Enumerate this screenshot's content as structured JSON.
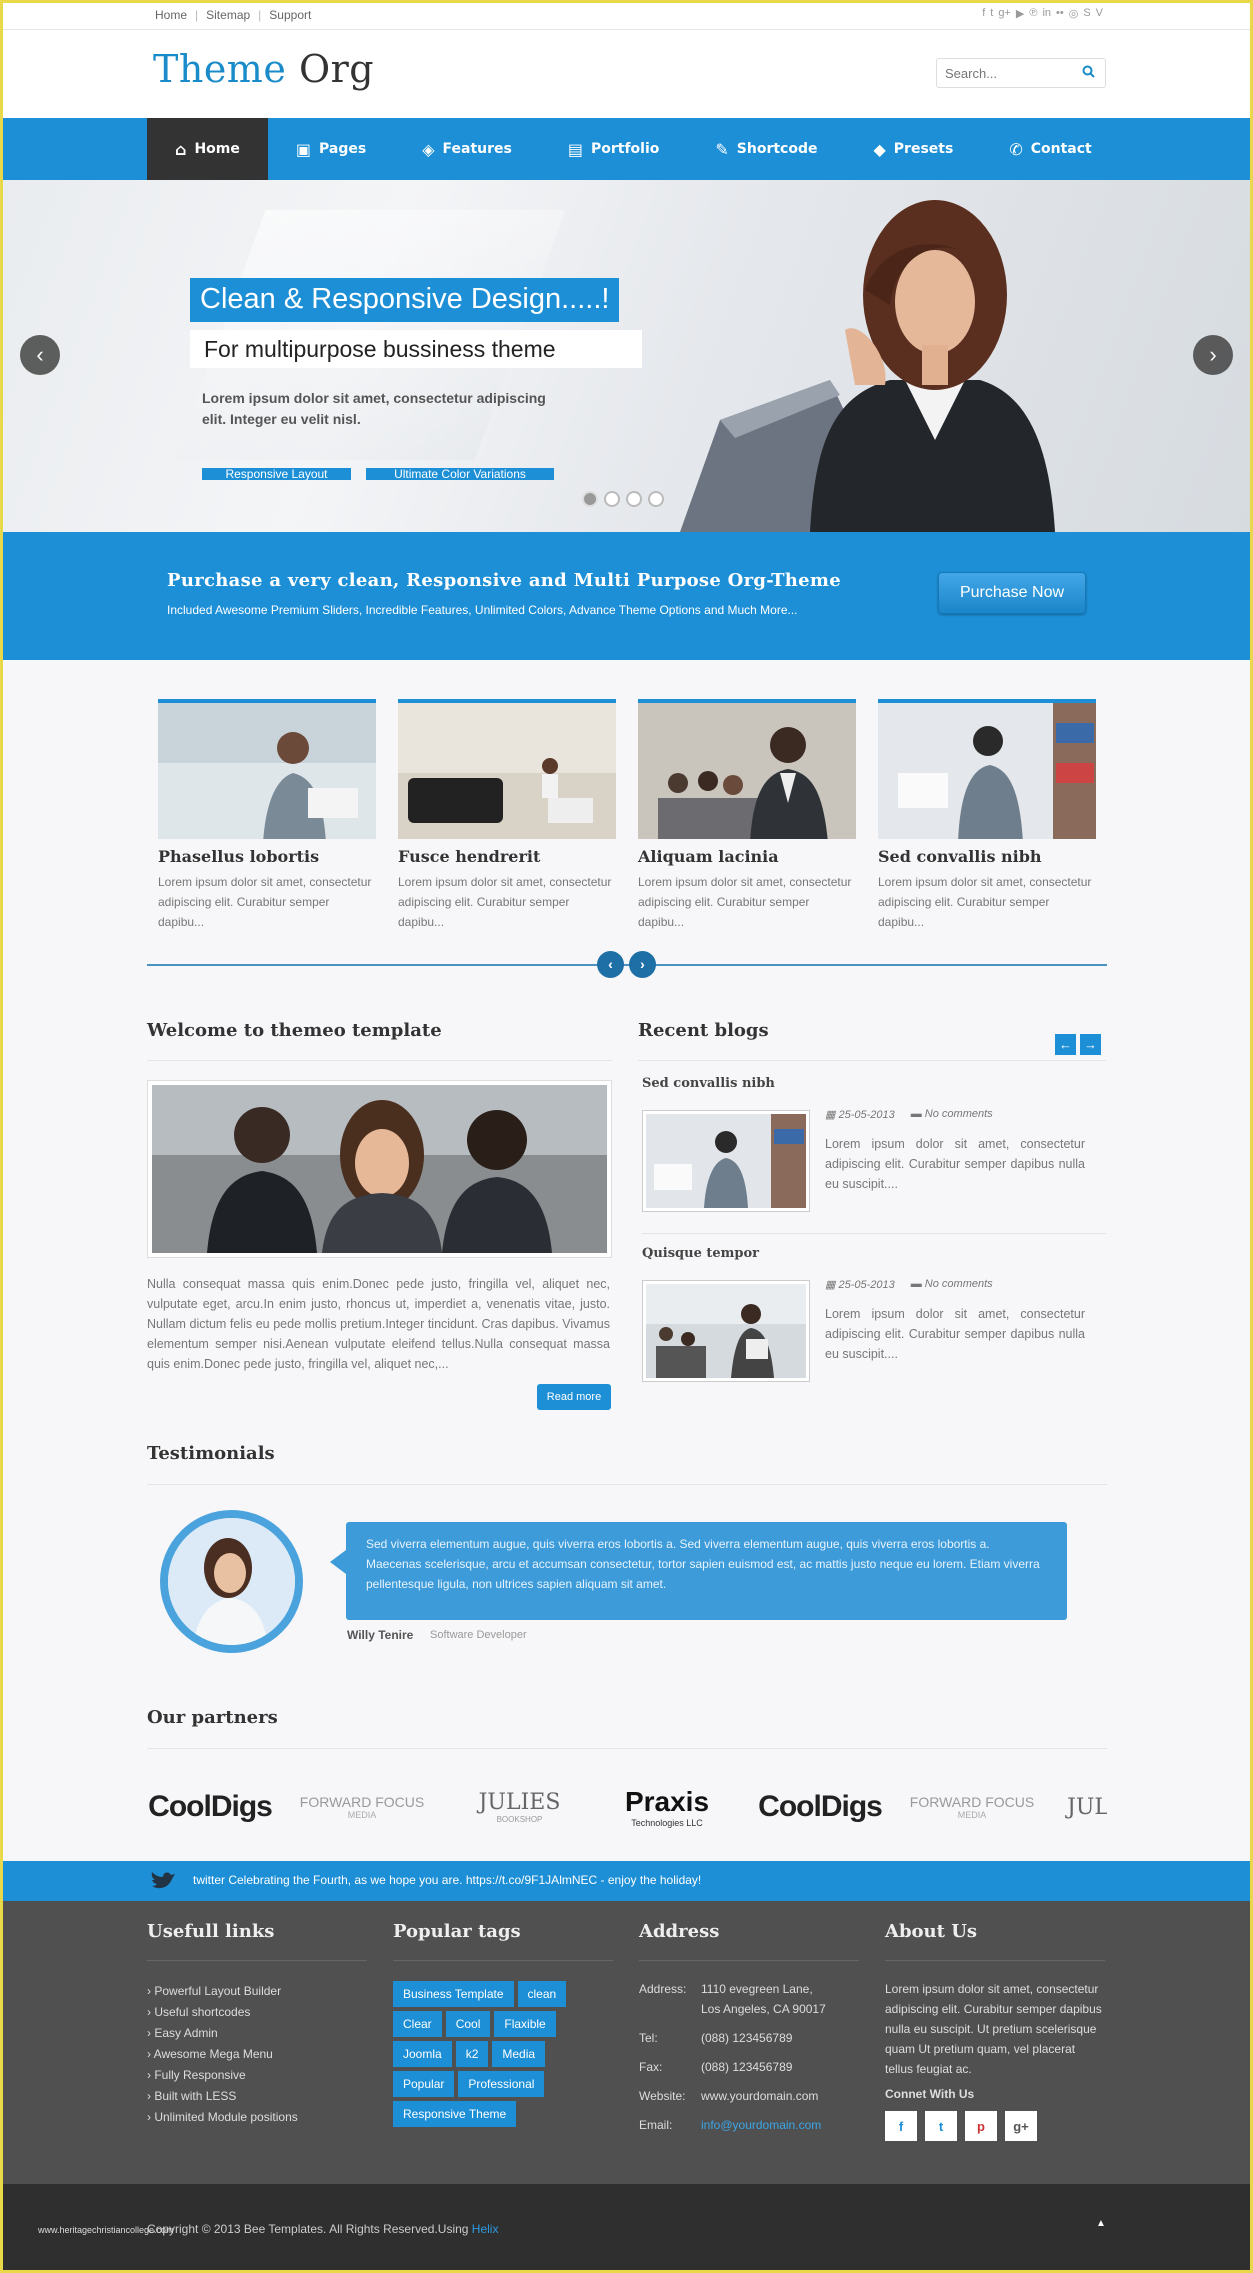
{
  "topbar": {
    "links": [
      "Home",
      "Sitemap",
      "Support"
    ],
    "social_icons": [
      "facebook-icon",
      "twitter-icon",
      "googleplus-icon",
      "youtube-icon",
      "pinterest-icon",
      "linkedin-icon",
      "flickr-icon",
      "dribbble-icon",
      "skype-icon",
      "vimeo-icon"
    ]
  },
  "header": {
    "logo_part1": "Theme",
    "logo_part2": "Org",
    "search_placeholder": "Search..."
  },
  "nav": {
    "items": [
      {
        "label": "Home",
        "icon": "home-icon"
      },
      {
        "label": "Pages",
        "icon": "image-icon"
      },
      {
        "label": "Features",
        "icon": "tag-icon"
      },
      {
        "label": "Portfolio",
        "icon": "book-icon"
      },
      {
        "label": "Shortcode",
        "icon": "edit-icon"
      },
      {
        "label": "Presets",
        "icon": "layers-icon"
      },
      {
        "label": "Contact",
        "icon": "phone-icon"
      }
    ]
  },
  "slider": {
    "title": "Clean & Responsive Design.....!",
    "subtitle": "For multipurpose bussiness theme",
    "text": "Lorem ipsum dolor sit amet, consectetur adipiscing elit. Integer eu velit nisl.",
    "btn1": "Responsive Layout",
    "btn2": "Ultimate Color Variations",
    "slide_count": 4,
    "active_slide": 1
  },
  "purchase": {
    "heading": "Purchase a very clean, Responsive and Multi Purpose Org-Theme",
    "text": "Included Awesome Premium Sliders, Incredible Features, Unlimited Colors, Advance Theme Options and Much More...",
    "button": "Purchase Now"
  },
  "features": [
    {
      "title": "Phasellus lobortis",
      "text": "Lorem ipsum dolor sit amet, consectetur adipiscing elit. Curabitur semper dapibu..."
    },
    {
      "title": "Fusce hendrerit",
      "text": "Lorem ipsum dolor sit amet, consectetur adipiscing elit. Curabitur semper dapibu..."
    },
    {
      "title": "Aliquam lacinia",
      "text": "Lorem ipsum dolor sit amet, consectetur adipiscing elit. Curabitur semper dapibu..."
    },
    {
      "title": "Sed convallis nibh",
      "text": "Lorem ipsum dolor sit amet, consectetur adipiscing elit. Curabitur semper dapibu..."
    }
  ],
  "welcome": {
    "heading": "Welcome to themeo template",
    "text": "Nulla consequat massa quis enim.Donec pede justo, fringilla vel, aliquet nec, vulputate eget, arcu.In enim justo, rhoncus ut, imperdiet a, venenatis vitae, justo. Nullam dictum felis eu pede mollis pretium.Integer tincidunt. Cras dapibus. Vivamus elementum semper nisi.Aenean vulputate eleifend tellus.Nulla consequat massa quis enim.Donec pede justo, fringilla vel, aliquet nec,...",
    "read_more": "Read more"
  },
  "blogs": {
    "heading": "Recent blogs",
    "posts": [
      {
        "title": "Sed convallis nibh",
        "date": "25-05-2013",
        "comments": "No comments",
        "text": "Lorem ipsum dolor sit amet, consectetur adipiscing elit. Curabitur semper dapibus nulla eu suscipit...."
      },
      {
        "title": "Quisque tempor",
        "date": "25-05-2013",
        "comments": "No comments",
        "text": "Lorem ipsum dolor sit amet, consectetur adipiscing elit. Curabitur semper dapibus nulla eu suscipit...."
      }
    ]
  },
  "testimonials": {
    "heading": "Testimonials",
    "quote": "Sed viverra elementum augue, quis viverra eros lobortis a. Sed viverra elementum augue, quis viverra eros lobortis a. Maecenas scelerisque, arcu et accumsan consectetur, tortor sapien euismod est, ac mattis justo neque eu lorem. Etiam viverra pellentesque ligula, non ultrices sapien aliquam sit amet.",
    "name": "Willy Tenire",
    "role": "Software Developer"
  },
  "partners": {
    "heading": "Our partners",
    "logos": [
      "CoolDigs",
      "FORWARD FOCUS",
      "JULIES",
      "Praxis",
      "CoolDigs",
      "FORWARD FOCUS",
      "JULIES"
    ],
    "forward_sub": "MEDIA",
    "praxis_sub": "Technologies LLC",
    "julies_sub": "BOOKSHOP"
  },
  "twitter": {
    "text": "twitter Celebrating the Fourth, as we hope you are. https://t.co/9F1JAlmNEC - enjoy the holiday!"
  },
  "footer": {
    "links_heading": "Usefull links",
    "links": [
      "Powerful Layout Builder",
      "Useful shortcodes",
      "Easy Admin",
      "Awesome Mega Menu",
      "Fully Responsive",
      "Built with LESS",
      "Unlimited Module positions"
    ],
    "tags_heading": "Popular tags",
    "tags": [
      "Business Template",
      "clean",
      "Clear",
      "Cool",
      "Flaxible",
      "Joomla",
      "k2",
      "Media",
      "Popular",
      "Professional",
      "Responsive Theme"
    ],
    "address_heading": "Address",
    "address": [
      {
        "key": "Address:",
        "value": "1110 evegreen Lane, Los Angeles, CA 90017"
      },
      {
        "key": "Tel:",
        "value": "(088) 123456789"
      },
      {
        "key": "Fax:",
        "value": "(088) 123456789"
      },
      {
        "key": "Website:",
        "value": "www.yourdomain.com"
      },
      {
        "key": "Email:",
        "value": "info@yourdomain.com"
      }
    ],
    "about_heading": "About Us",
    "about_text": "Lorem ipsum dolor sit amet, consectetur adipiscing elit. Curabitur semper dapibus nulla eu suscipit. Ut pretium scelerisque quam Ut pretium quam, vel placerat tellus feugiat ac.",
    "connect_heading": "Connet With Us",
    "social": [
      "f",
      "t",
      "p",
      "g+"
    ]
  },
  "bottom": {
    "copyright": "Copyright © 2013 Bee Templates. All Rights Reserved.Using",
    "helix": "Helix",
    "watermark": "www.heritagechristiancollege.com"
  },
  "colors": {
    "accent": "#1d8fd6",
    "dark": "#333333",
    "footer": "#505050"
  }
}
